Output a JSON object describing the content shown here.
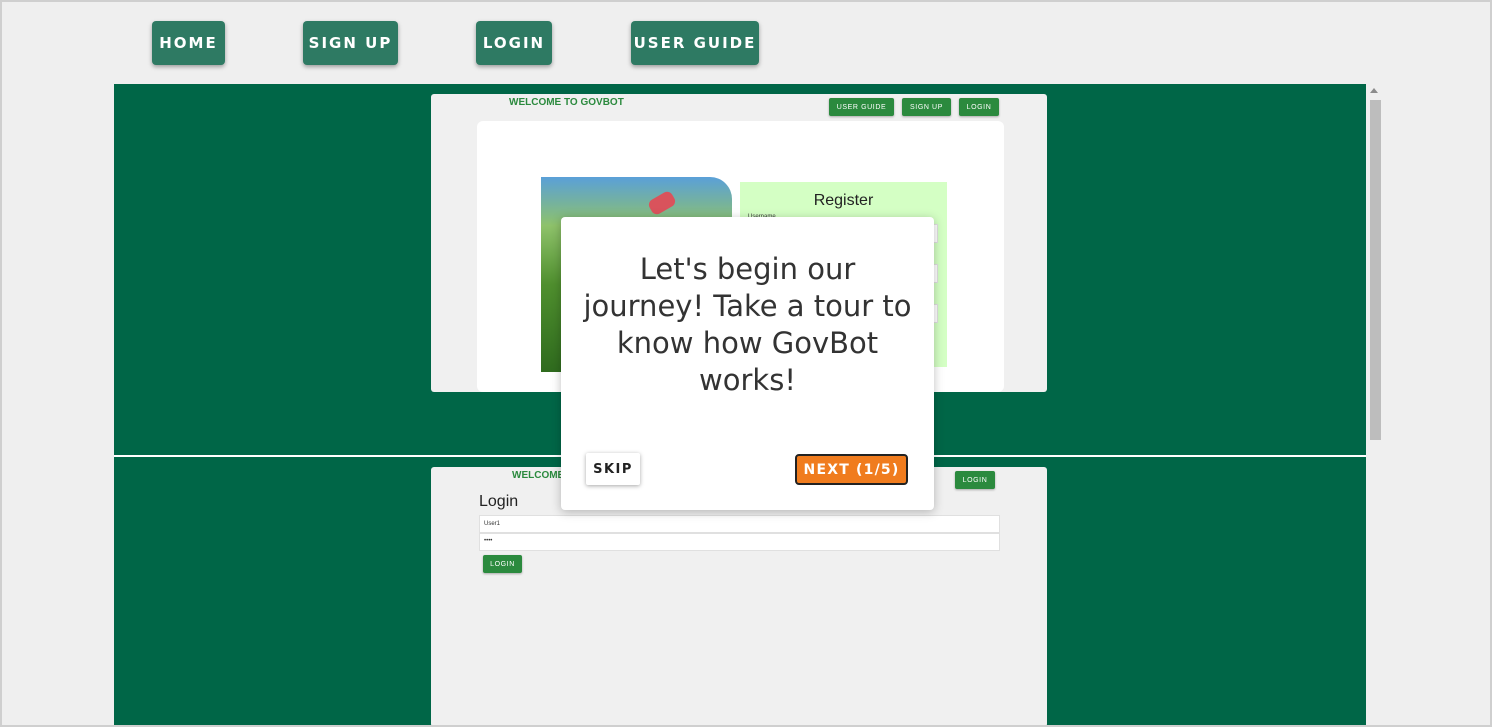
{
  "nav": {
    "home": "HOME",
    "signup": "SIGN UP",
    "login": "LOGIN",
    "user_guide": "USER GUIDE"
  },
  "preview_top": {
    "welcome": "WELCOME TO GOVBOT",
    "buttons": [
      "USER GUIDE",
      "SIGN UP",
      "LOGIN"
    ],
    "register_title": "Register",
    "username_label": "Username"
  },
  "preview_bottom": {
    "welcome": "WELCOME",
    "login_button_top": "LOGIN",
    "login_title": "Login",
    "username_value": "User1",
    "password_value": "••••",
    "login_button": "LOGIN"
  },
  "tour": {
    "message": "Let's begin our journey! Take a tour to know how GovBot works!",
    "skip": "SKIP",
    "next": "NEXT (1/5)"
  },
  "colors": {
    "panel": "#006647",
    "nav_button": "#2e7a63",
    "next_button": "#f07c1e",
    "register_bg": "#d4ffc4"
  }
}
